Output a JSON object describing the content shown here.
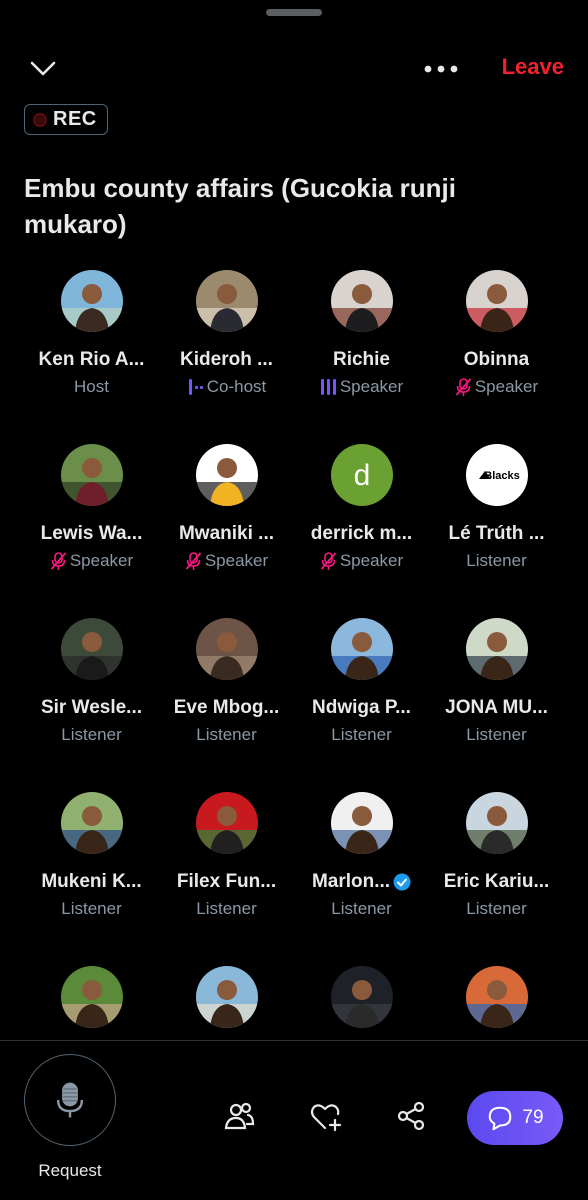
{
  "header": {
    "leave_label": "Leave",
    "rec_label": "REC"
  },
  "space": {
    "title": "Embu county affairs (Gucokia runji mukaro)"
  },
  "participants": [
    {
      "name": "Ken Rio A...",
      "role": "Host",
      "role_icon": "none"
    },
    {
      "name": "Kideroh ...",
      "role": "Co-host",
      "role_icon": "speaking-dots-icon"
    },
    {
      "name": "Richie",
      "role": "Speaker",
      "role_icon": "speaking-bars-icon"
    },
    {
      "name": "Obinna",
      "role": "Speaker",
      "role_icon": "mic-muted-icon"
    },
    {
      "name": "Lewis Wa...",
      "role": "Speaker",
      "role_icon": "mic-muted-icon"
    },
    {
      "name": "Mwaniki ...",
      "role": "Speaker",
      "role_icon": "mic-muted-icon"
    },
    {
      "name": "derrick m...",
      "role": "Speaker",
      "role_icon": "mic-muted-icon",
      "avatar_letter": "d"
    },
    {
      "name": "Lé Trúth ...",
      "role": "Listener",
      "role_icon": "none",
      "avatar_text": "Blacks"
    },
    {
      "name": "Sir Wesle...",
      "role": "Listener",
      "role_icon": "none"
    },
    {
      "name": "Eve Mbog...",
      "role": "Listener",
      "role_icon": "none"
    },
    {
      "name": "Ndwiga P...",
      "role": "Listener",
      "role_icon": "none"
    },
    {
      "name": "JONA MU...",
      "role": "Listener",
      "role_icon": "none"
    },
    {
      "name": "Mukeni K...",
      "role": "Listener",
      "role_icon": "none"
    },
    {
      "name": "Filex Fun...",
      "role": "Listener",
      "role_icon": "none"
    },
    {
      "name": "Marlon...",
      "role": "Listener",
      "role_icon": "verified-badge-icon"
    },
    {
      "name": "Eric Kariu...",
      "role": "Listener",
      "role_icon": "none"
    },
    {
      "name": "",
      "role": "",
      "role_icon": "none"
    },
    {
      "name": "",
      "role": "",
      "role_icon": "none"
    },
    {
      "name": "",
      "role": "",
      "role_icon": "none"
    },
    {
      "name": "",
      "role": "",
      "role_icon": "none"
    }
  ],
  "bottom": {
    "request_label": "Request",
    "chat_count": "79"
  },
  "colors": {
    "background": "#000000",
    "leave": "#f4212e",
    "muted_icon": "#f91880",
    "speaking_icon": "#7856ff",
    "secondary_text": "#8b98a5",
    "chat_button": "#6a52f4",
    "verified": "#1d9bf0"
  }
}
